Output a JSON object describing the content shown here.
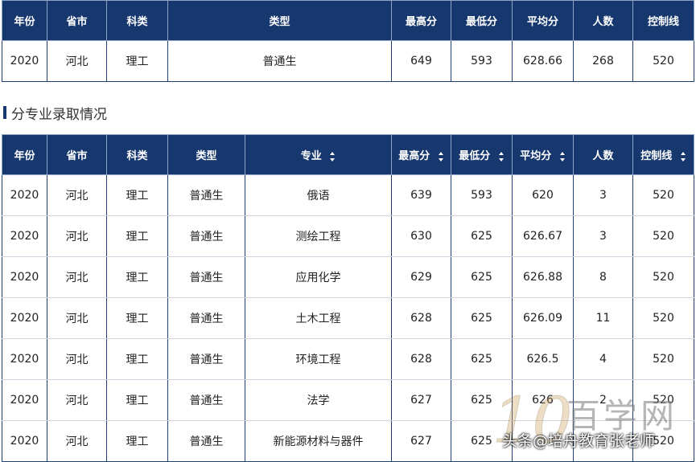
{
  "summary": {
    "headers": [
      "年份",
      "省市",
      "科类",
      "类型",
      "最高分",
      "最低分",
      "平均分",
      "人数",
      "控制线"
    ],
    "row": [
      "2020",
      "河北",
      "理工",
      "普通生",
      "649",
      "593",
      "628.66",
      "268",
      "520"
    ]
  },
  "section_title": "分专业录取情况",
  "majors": {
    "headers": [
      "年份",
      "省市",
      "科类",
      "类型",
      "专业",
      "最高分",
      "最低分",
      "平均分",
      "人数",
      "控制线"
    ],
    "rows": [
      [
        "2020",
        "河北",
        "理工",
        "普通生",
        "俄语",
        "639",
        "593",
        "620",
        "3",
        "520"
      ],
      [
        "2020",
        "河北",
        "理工",
        "普通生",
        "测绘工程",
        "630",
        "625",
        "626.67",
        "3",
        "520"
      ],
      [
        "2020",
        "河北",
        "理工",
        "普通生",
        "应用化学",
        "629",
        "625",
        "626.88",
        "8",
        "520"
      ],
      [
        "2020",
        "河北",
        "理工",
        "普通生",
        "土木工程",
        "628",
        "625",
        "626.09",
        "11",
        "520"
      ],
      [
        "2020",
        "河北",
        "理工",
        "普通生",
        "环境工程",
        "628",
        "625",
        "626.5",
        "4",
        "520"
      ],
      [
        "2020",
        "河北",
        "理工",
        "普通生",
        "法学",
        "627",
        "625",
        "626",
        "2",
        "520"
      ],
      [
        "2020",
        "河北",
        "理工",
        "普通生",
        "新能源材料与器件",
        "627",
        "625",
        "",
        "",
        "520"
      ]
    ]
  },
  "watermark": {
    "logo_text": "100",
    "site_text": "百学网",
    "author_text": "头条@培舟教育张老师"
  }
}
